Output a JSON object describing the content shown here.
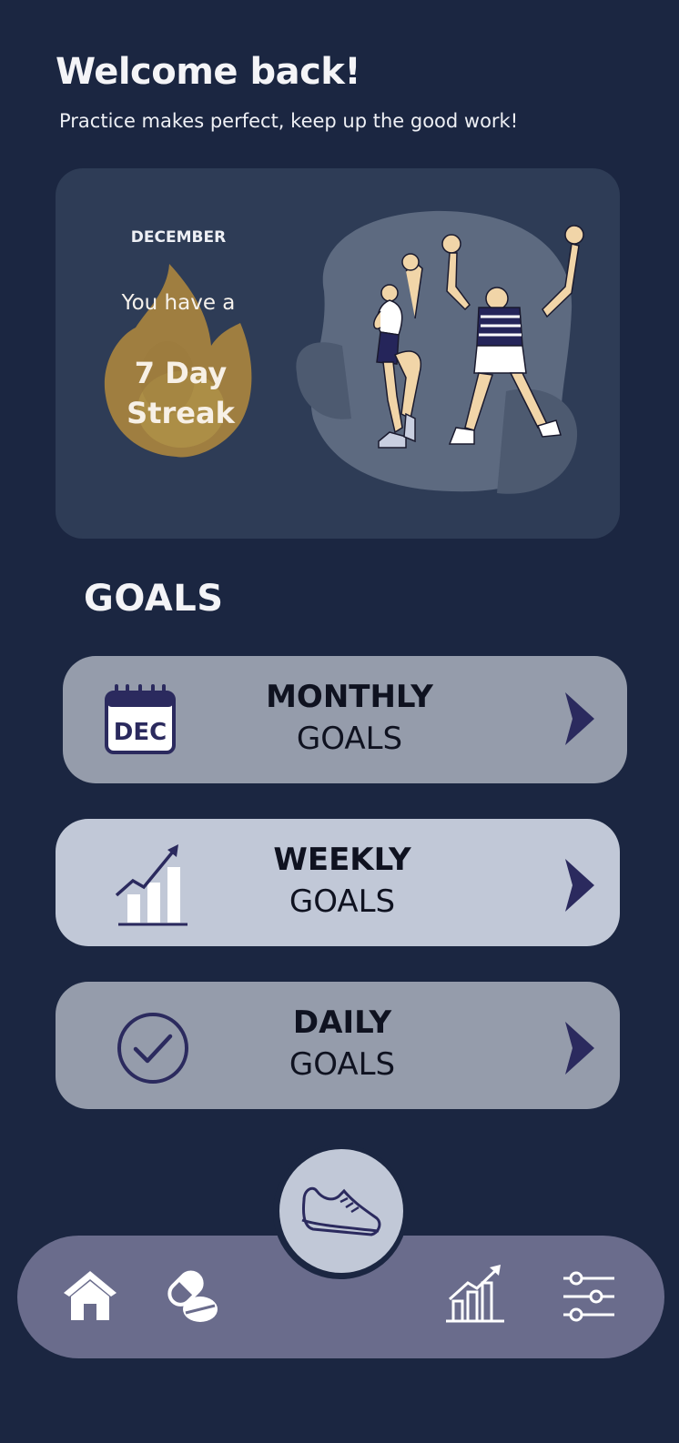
{
  "header": {
    "title": "Welcome back!",
    "subtitle": "Practice makes perfect, keep up the good work!"
  },
  "streak_card": {
    "month": "DECEMBER",
    "prefix": "You have a",
    "count_line1": "7 Day",
    "count_line2": "Streak",
    "flame_color": "#b08a3e",
    "illustration": "two-people-celebrating"
  },
  "goals": {
    "heading": "GOALS",
    "items": [
      {
        "strong": "MONTHLY",
        "light": "GOALS",
        "icon": "calendar-icon",
        "icon_text": "DEC"
      },
      {
        "strong": "WEEKLY",
        "light": "GOALS",
        "icon": "growth-chart-icon"
      },
      {
        "strong": "DAILY",
        "light": "GOALS",
        "icon": "check-circle-icon"
      }
    ]
  },
  "nav": {
    "items": [
      "home-icon",
      "pills-icon",
      "sneaker-icon",
      "chart-icon",
      "sliders-icon"
    ]
  },
  "colors": {
    "background": "#1b2641",
    "card": "#2e3c56",
    "goal_dark": "#959cab",
    "goal_light": "#c1c8d7",
    "accent": "#2b2a5e",
    "nav_bar": "#6a6c8c"
  }
}
